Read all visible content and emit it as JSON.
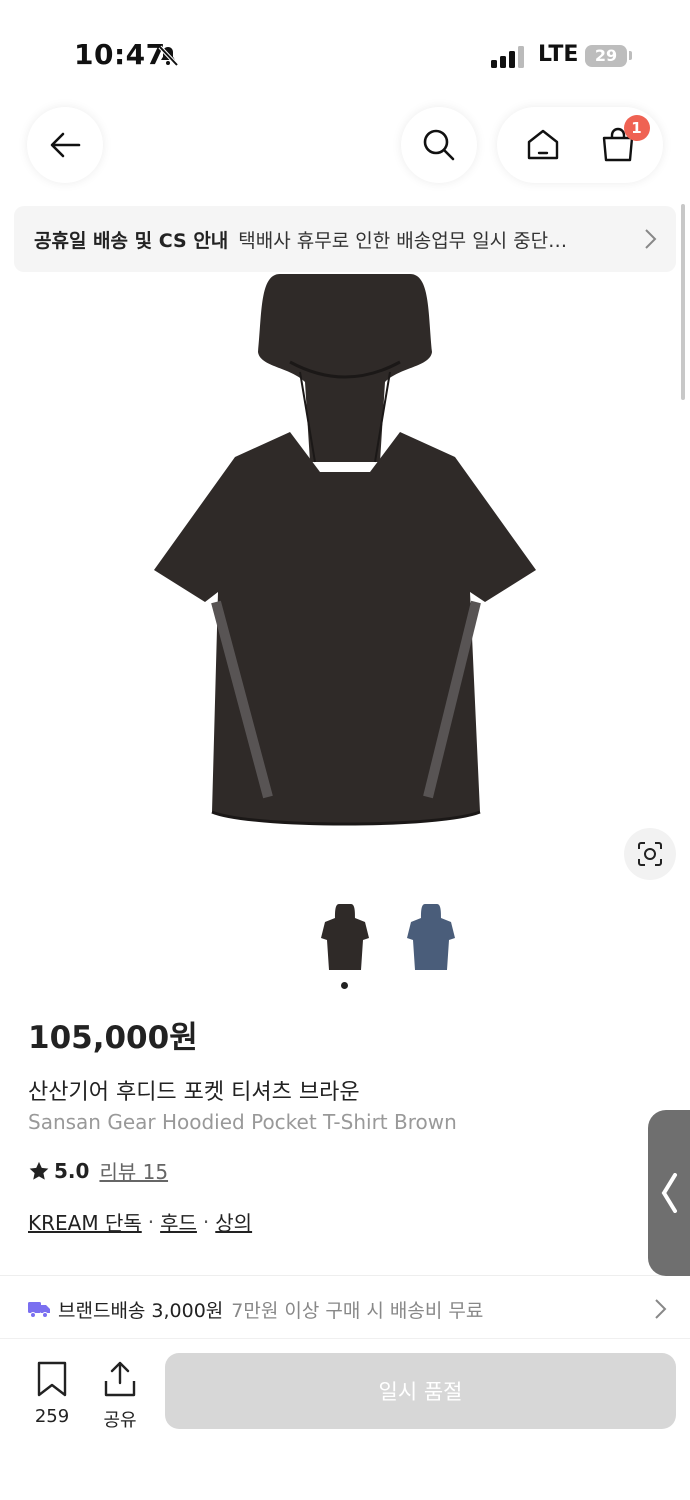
{
  "status_bar": {
    "time": "10:47",
    "network": "LTE",
    "battery": "29"
  },
  "nav": {
    "cart_count": "1"
  },
  "notice": {
    "title": "공휴일 배송 및 CS 안내",
    "text": "택배사 휴무로 인한 배송업무 일시 중단…"
  },
  "product": {
    "price": "105,000원",
    "name_ko": "산산기어 후디드 포켓 티셔츠 브라운",
    "name_en": "Sansan Gear Hoodied Pocket T-Shirt Brown",
    "rating": "5.0",
    "review_label": "리뷰 15",
    "tags": [
      "KREAM 단독",
      "후드",
      "상의"
    ],
    "tag_separator": "·"
  },
  "shipping": {
    "label": "브랜드배송",
    "fee": "3,000원",
    "note": "7만원 이상 구매 시 배송비 무료"
  },
  "bottom_bar": {
    "save_count": "259",
    "share_label": "공유",
    "soldout_label": "일시 품절"
  },
  "colors": {
    "accent_badge": "#ef6253",
    "shipping_icon": "#7a6ff0",
    "button_disabled": "#d7d7d7",
    "product_brown": "#2f2a28",
    "product_blue": "#4a5d7a"
  }
}
